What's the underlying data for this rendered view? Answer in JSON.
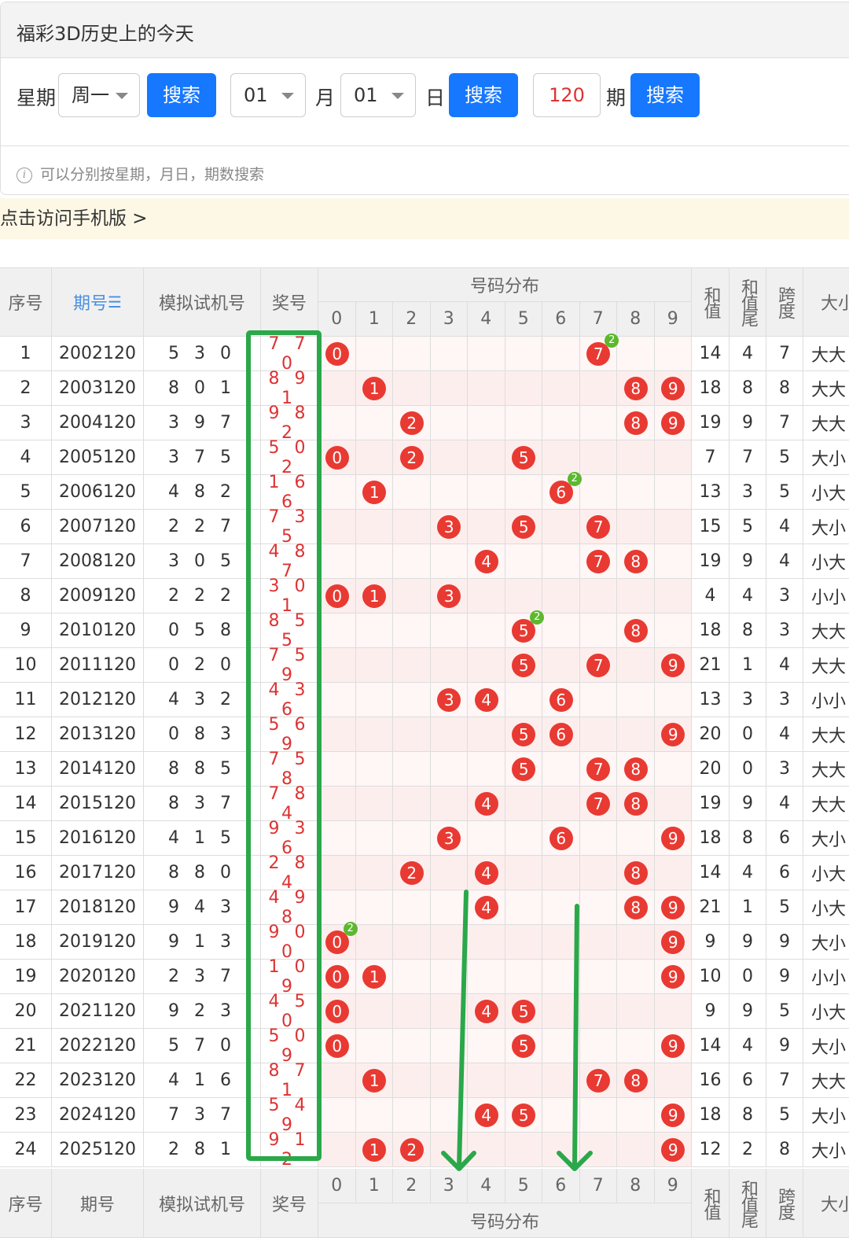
{
  "panel": {
    "title": "福彩3D历史上的今天"
  },
  "search": {
    "week_label": "星期",
    "week_value": "周一",
    "search_label": "搜索",
    "month_value": "01",
    "month_unit": "月",
    "day_value": "01",
    "day_unit": "日",
    "period_value": "120",
    "period_unit": "期",
    "tip": "可以分别按星期，月日，期数搜索"
  },
  "mobile_link": "点击访问手机版 >",
  "table": {
    "headers": {
      "seq": "序号",
      "issue": "期号",
      "sim": "模拟试机号",
      "prize": "奖号",
      "dist": "号码分布",
      "sum": "和值",
      "sum_tail": "和值尾",
      "span": "跨度",
      "size": "大小"
    },
    "digits": [
      "0",
      "1",
      "2",
      "3",
      "4",
      "5",
      "6",
      "7",
      "8",
      "9"
    ],
    "rows": [
      {
        "seq": "1",
        "issue": "2002120",
        "sim": "5 3 0",
        "prize": "7 7 0",
        "sum": "14",
        "tail": "4",
        "span": "7",
        "size": "大大"
      },
      {
        "seq": "2",
        "issue": "2003120",
        "sim": "8 0 1",
        "prize": "8 9 1",
        "sum": "18",
        "tail": "8",
        "span": "8",
        "size": "大大"
      },
      {
        "seq": "3",
        "issue": "2004120",
        "sim": "3 9 7",
        "prize": "9 8 2",
        "sum": "19",
        "tail": "9",
        "span": "7",
        "size": "大大"
      },
      {
        "seq": "4",
        "issue": "2005120",
        "sim": "3 7 5",
        "prize": "5 0 2",
        "sum": "7",
        "tail": "7",
        "span": "5",
        "size": "大小"
      },
      {
        "seq": "5",
        "issue": "2006120",
        "sim": "4 8 2",
        "prize": "1 6 6",
        "sum": "13",
        "tail": "3",
        "span": "5",
        "size": "小大"
      },
      {
        "seq": "6",
        "issue": "2007120",
        "sim": "2 2 7",
        "prize": "7 3 5",
        "sum": "15",
        "tail": "5",
        "span": "4",
        "size": "大小"
      },
      {
        "seq": "7",
        "issue": "2008120",
        "sim": "3 0 5",
        "prize": "4 8 7",
        "sum": "19",
        "tail": "9",
        "span": "4",
        "size": "小大"
      },
      {
        "seq": "8",
        "issue": "2009120",
        "sim": "2 2 2",
        "prize": "3 0 1",
        "sum": "4",
        "tail": "4",
        "span": "3",
        "size": "小小"
      },
      {
        "seq": "9",
        "issue": "2010120",
        "sim": "0 5 8",
        "prize": "8 5 5",
        "sum": "18",
        "tail": "8",
        "span": "3",
        "size": "大大"
      },
      {
        "seq": "10",
        "issue": "2011120",
        "sim": "0 2 0",
        "prize": "7 5 9",
        "sum": "21",
        "tail": "1",
        "span": "4",
        "size": "大大"
      },
      {
        "seq": "11",
        "issue": "2012120",
        "sim": "4 3 2",
        "prize": "4 3 6",
        "sum": "13",
        "tail": "3",
        "span": "3",
        "size": "小小"
      },
      {
        "seq": "12",
        "issue": "2013120",
        "sim": "0 8 3",
        "prize": "5 6 9",
        "sum": "20",
        "tail": "0",
        "span": "4",
        "size": "大大"
      },
      {
        "seq": "13",
        "issue": "2014120",
        "sim": "8 8 5",
        "prize": "7 5 8",
        "sum": "20",
        "tail": "0",
        "span": "3",
        "size": "大大"
      },
      {
        "seq": "14",
        "issue": "2015120",
        "sim": "8 3 7",
        "prize": "7 8 4",
        "sum": "19",
        "tail": "9",
        "span": "4",
        "size": "大大"
      },
      {
        "seq": "15",
        "issue": "2016120",
        "sim": "4 1 5",
        "prize": "9 3 6",
        "sum": "18",
        "tail": "8",
        "span": "6",
        "size": "大小"
      },
      {
        "seq": "16",
        "issue": "2017120",
        "sim": "8 8 0",
        "prize": "2 8 4",
        "sum": "14",
        "tail": "4",
        "span": "6",
        "size": "小大"
      },
      {
        "seq": "17",
        "issue": "2018120",
        "sim": "9 4 3",
        "prize": "4 9 8",
        "sum": "21",
        "tail": "1",
        "span": "5",
        "size": "小大"
      },
      {
        "seq": "18",
        "issue": "2019120",
        "sim": "9 1 3",
        "prize": "9 0 0",
        "sum": "9",
        "tail": "9",
        "span": "9",
        "size": "大小"
      },
      {
        "seq": "19",
        "issue": "2020120",
        "sim": "2 3 7",
        "prize": "1 0 9",
        "sum": "10",
        "tail": "0",
        "span": "9",
        "size": "小小"
      },
      {
        "seq": "20",
        "issue": "2021120",
        "sim": "9 2 3",
        "prize": "4 5 0",
        "sum": "9",
        "tail": "9",
        "span": "5",
        "size": "小大"
      },
      {
        "seq": "21",
        "issue": "2022120",
        "sim": "5 7 0",
        "prize": "5 0 9",
        "sum": "14",
        "tail": "4",
        "span": "9",
        "size": "大小"
      },
      {
        "seq": "22",
        "issue": "2023120",
        "sim": "4 1 6",
        "prize": "8 7 1",
        "sum": "16",
        "tail": "6",
        "span": "7",
        "size": "大大"
      },
      {
        "seq": "23",
        "issue": "2024120",
        "sim": "7 3 7",
        "prize": "5 4 9",
        "sum": "18",
        "tail": "8",
        "span": "5",
        "size": "大小"
      },
      {
        "seq": "24",
        "issue": "2025120",
        "sim": "2 8 1",
        "prize": "9 1 2",
        "sum": "12",
        "tail": "2",
        "span": "8",
        "size": "大小"
      }
    ]
  },
  "colors": {
    "ball": "#e83a32",
    "twin": "#5cb82d",
    "annotation": "#2aa84a",
    "button": "#1677ff"
  }
}
